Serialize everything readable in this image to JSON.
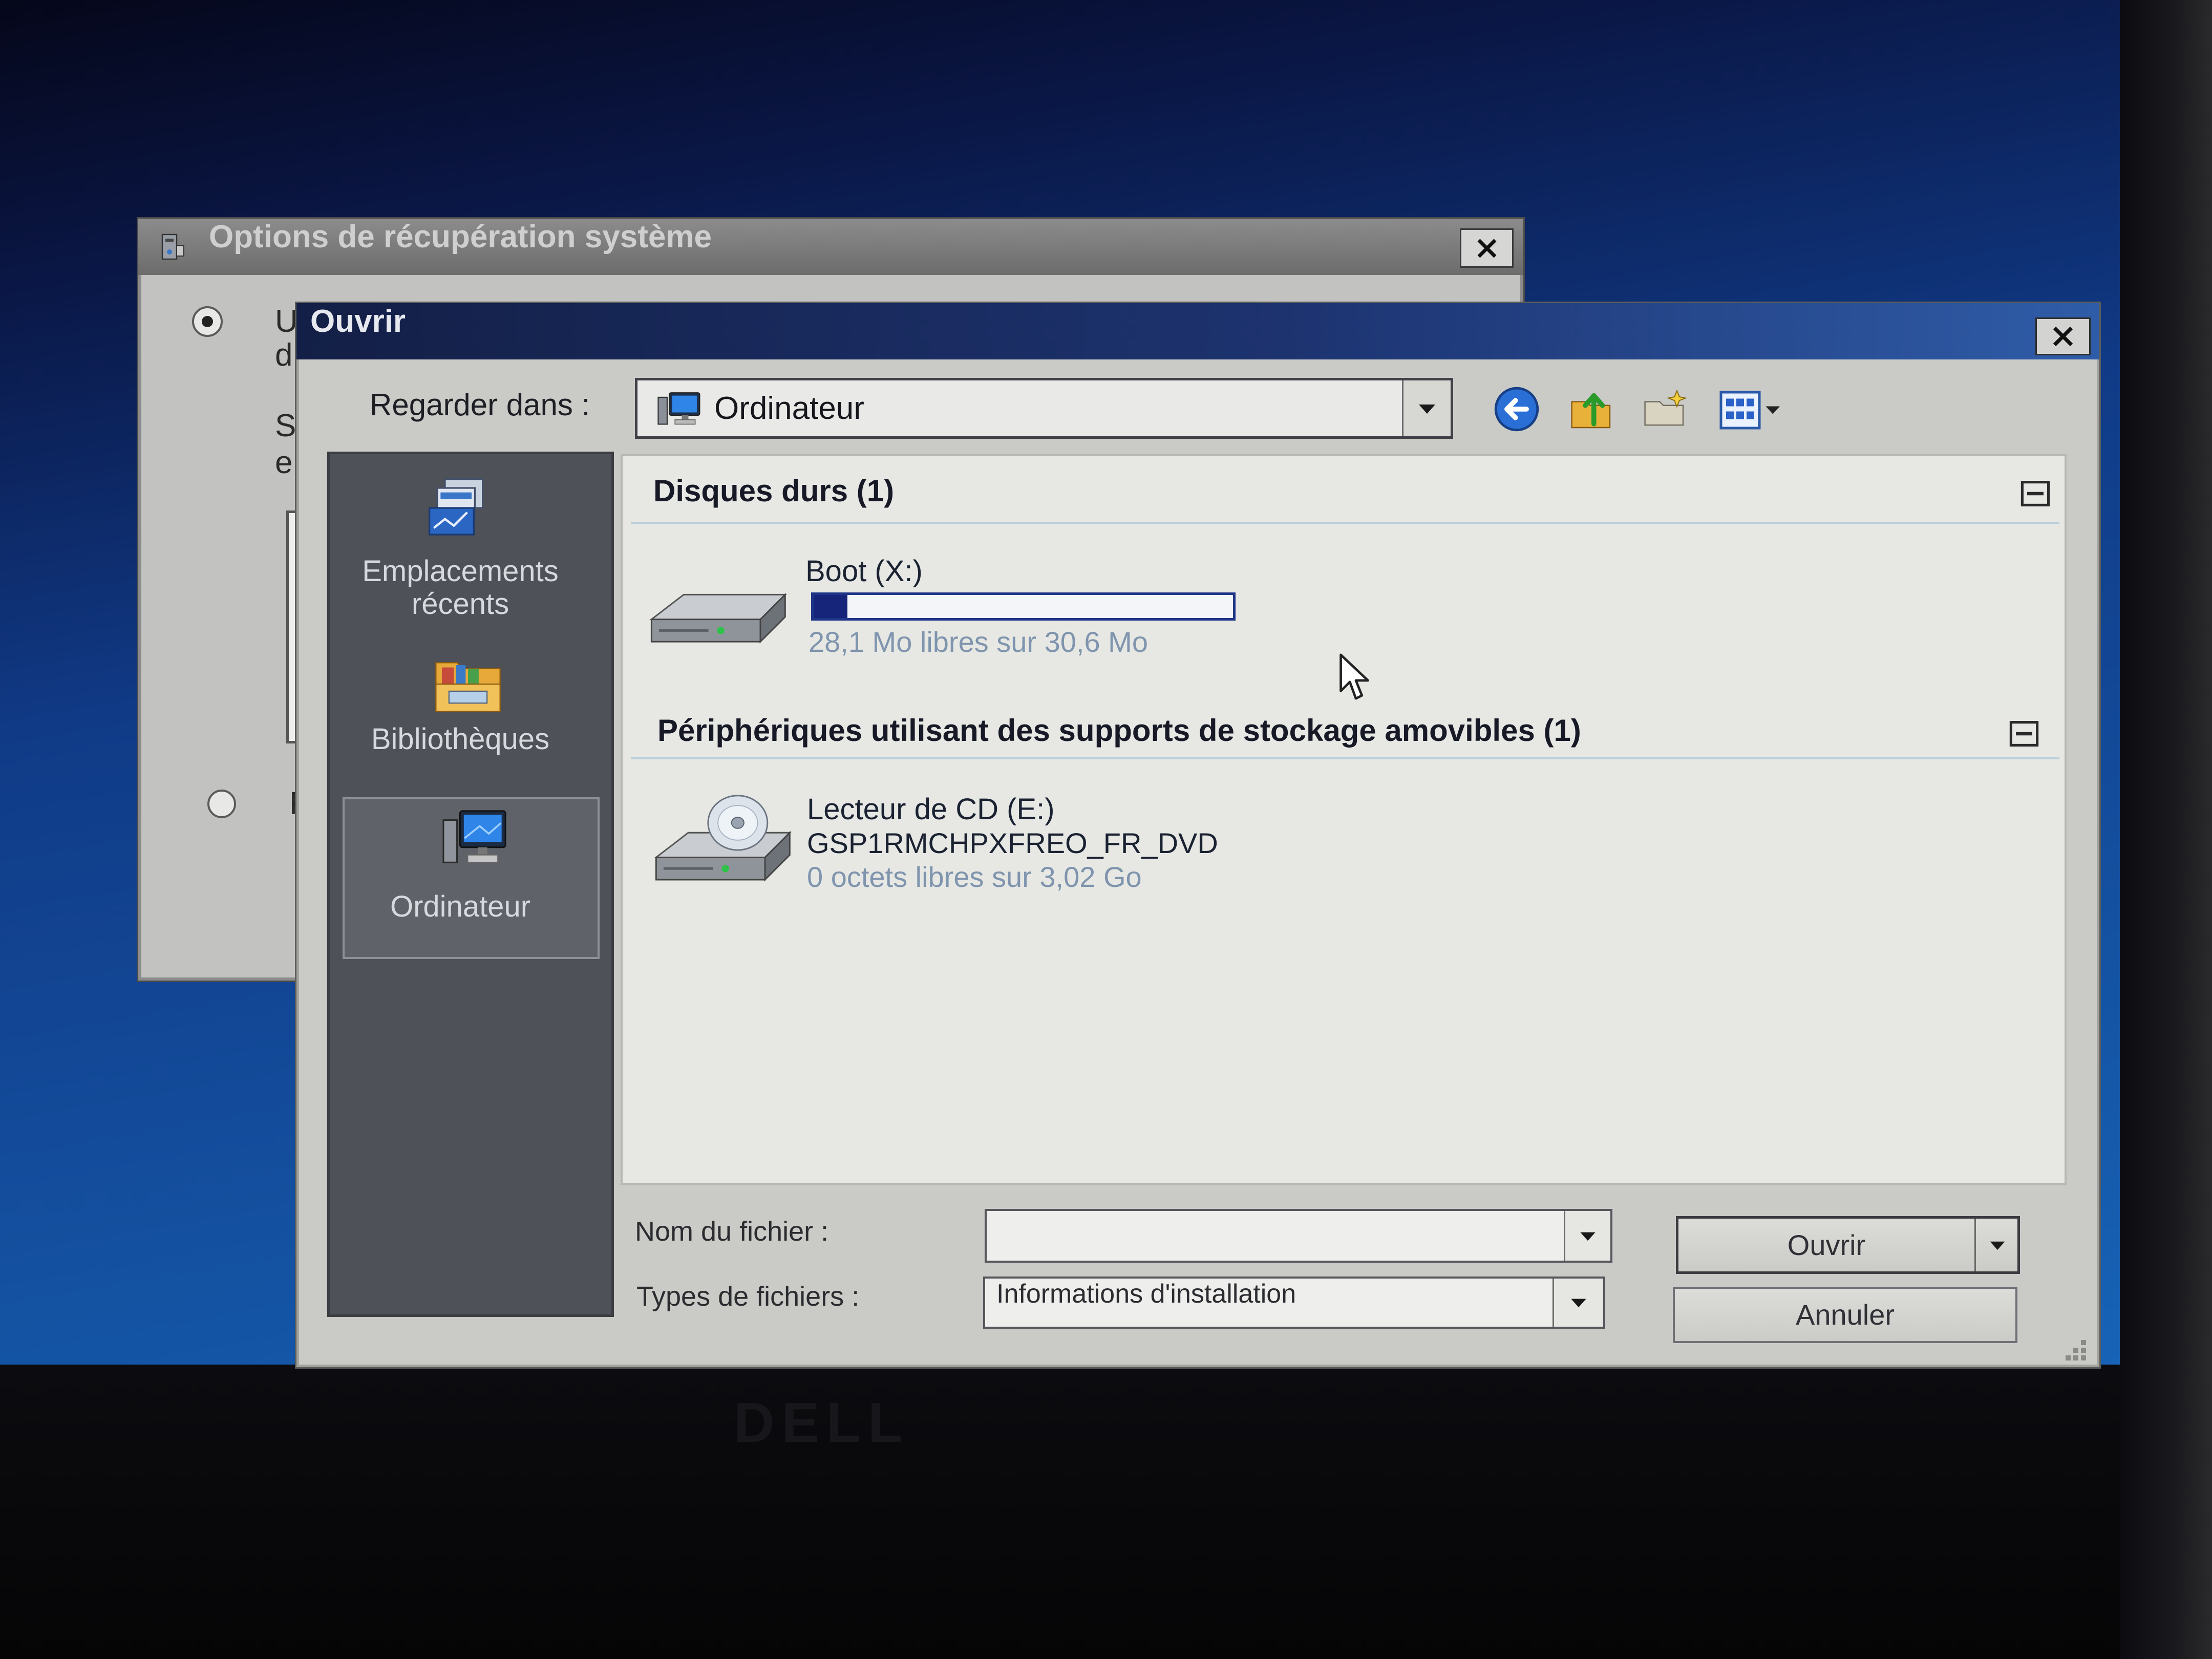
{
  "monitor": {
    "logo": "DELL"
  },
  "colors": {
    "desktop_top": "#05071a",
    "desktop_bottom": "#1763b6",
    "title_active_left": "#131f46",
    "title_active_right": "#2f5ca8",
    "title_inactive": "#7b7b7b",
    "places_bg": "#4e5157",
    "places_selected": "#5f6268",
    "content_bg": "#e7e8e4",
    "progress_fill": "#16257a",
    "secondary_text": "#7f94ad",
    "group_rule": "#b9d0dc"
  },
  "background_window": {
    "title": "Options de récupération système",
    "title_icon": "recovery-app-icon",
    "text_fragments": [
      "U",
      "d",
      "S",
      "e"
    ],
    "option_fragment": "R"
  },
  "dialog": {
    "title": "Ouvrir",
    "look_in": {
      "label": "Regarder dans :",
      "value": "Ordinateur",
      "icon": "computer-icon"
    },
    "toolbar": [
      "back-icon",
      "up-folder-icon",
      "new-folder-icon",
      "views-menu-icon"
    ],
    "places": [
      {
        "label": "Emplacements récents",
        "icon": "recent-places-icon"
      },
      {
        "label": "Bibliothèques",
        "icon": "libraries-icon"
      },
      {
        "label": "Ordinateur",
        "icon": "computer-icon",
        "selected": true
      }
    ],
    "groups": [
      {
        "header": "Disques durs (1)",
        "items": [
          {
            "name": "Boot (X:)",
            "free_space": "28,1 Mo libres sur 30,6 Mo",
            "used_fraction": 0.08,
            "icon": "hard-drive-icon"
          }
        ]
      },
      {
        "header": "Périphériques utilisant des supports de stockage amovibles (1)",
        "items": [
          {
            "name": "Lecteur de CD (E:)",
            "volume_label": "GSP1RMCHPXFREO_FR_DVD",
            "free_space": "0 octets libres sur 3,02 Go",
            "icon": "cd-drive-icon"
          }
        ]
      }
    ],
    "file_name": {
      "label": "Nom du fichier :",
      "value": ""
    },
    "file_type": {
      "label": "Types de fichiers :",
      "value": "Informations d'installation"
    },
    "buttons": {
      "open": "Ouvrir",
      "cancel": "Annuler"
    }
  }
}
